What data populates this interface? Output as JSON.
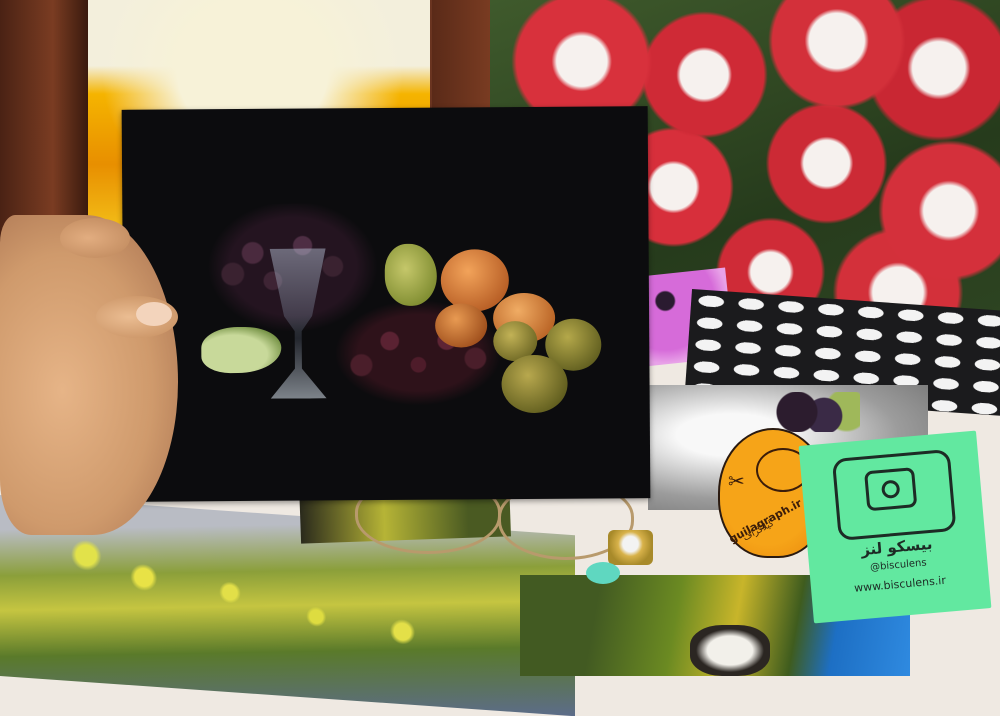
{
  "orange_sticker": {
    "brand": "guilagraph.ir",
    "sub_text": "گیلاگراف",
    "icon": "scissors-icon"
  },
  "green_sticker": {
    "brand": "بیسکو لنز",
    "handle": "@bisculens",
    "site": "www.bisculens.ir",
    "icon": "camera-icon",
    "color": "#62e8a0"
  }
}
